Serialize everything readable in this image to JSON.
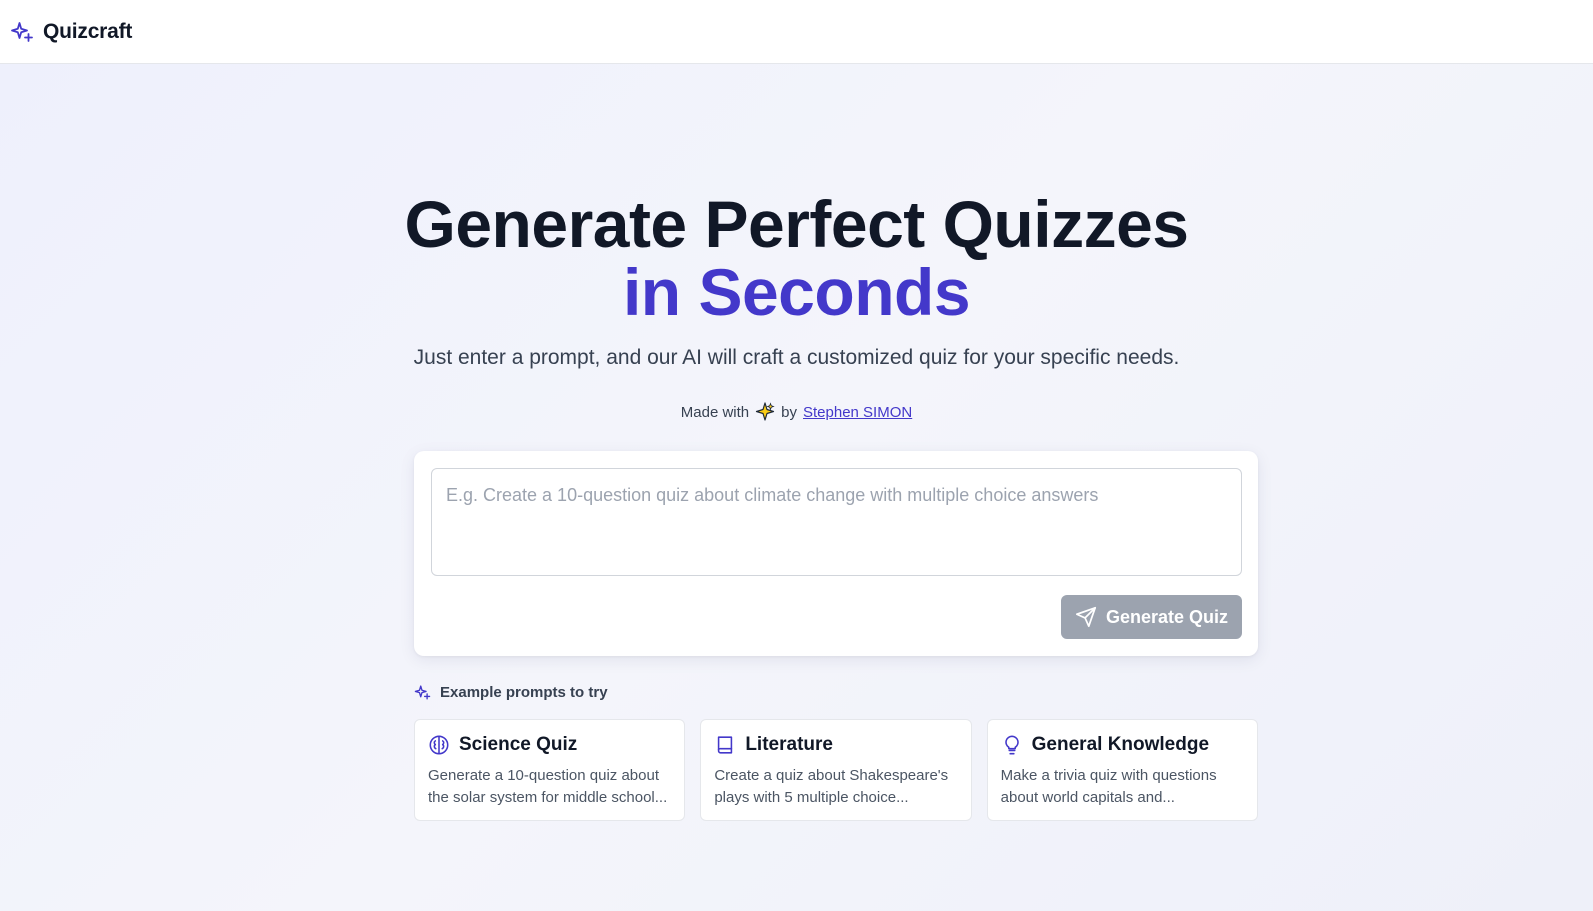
{
  "app": {
    "name": "Quizcraft",
    "logo_icon": "sparkles-icon",
    "accent_color": "#4338ca"
  },
  "hero": {
    "title_line1": "Generate Perfect Quizzes",
    "title_line2": "in Seconds",
    "subtitle": "Just enter a prompt, and our AI will craft a customized quiz for your specific needs."
  },
  "credit": {
    "prefix": "Made with",
    "emoji_icon": "sparkle-emoji-icon",
    "by": "by",
    "author": "Stephen SIMON"
  },
  "prompt": {
    "value": "",
    "placeholder": "E.g. Create a 10-question quiz about climate change with multiple choice answers"
  },
  "generate_button": {
    "label": "Generate Quiz",
    "icon": "send-icon",
    "disabled": true
  },
  "examples": {
    "heading": "Example prompts to try",
    "icon": "sparkles-icon",
    "items": [
      {
        "title": "Science Quiz",
        "icon": "brain-icon",
        "description": "Generate a 10-question quiz about the solar system for middle school..."
      },
      {
        "title": "Literature",
        "icon": "book-icon",
        "description": "Create a quiz about Shakespeare's plays with 5 multiple choice..."
      },
      {
        "title": "General Knowledge",
        "icon": "lightbulb-icon",
        "description": "Make a trivia quiz with questions about world capitals and..."
      }
    ]
  }
}
